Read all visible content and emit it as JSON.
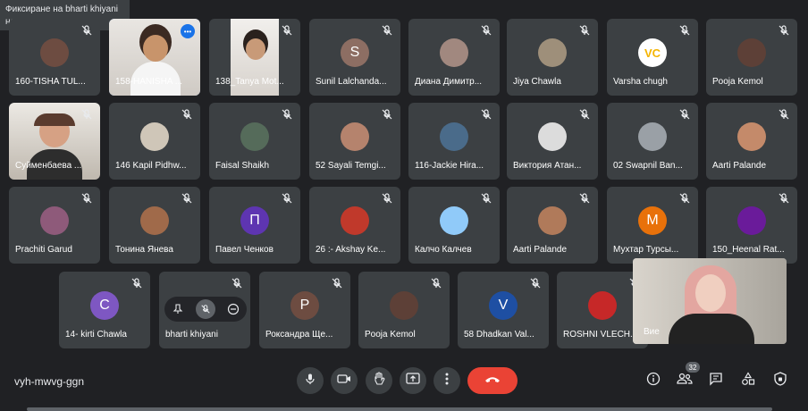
{
  "tooltip": "Фиксиране на bharti khiyani на основния ви екран",
  "meeting_code": "vyh-mwvg-ggn",
  "participant_count": "32",
  "self_label": "Вие",
  "tiles": [
    {
      "name": "160-TISHA TUL..."
    },
    {
      "name": "158-HANISHA ..."
    },
    {
      "name": "138_Tanya Mot..."
    },
    {
      "name": "Sunil Lalchanda...",
      "initial": "S",
      "color": "#8d6e63"
    },
    {
      "name": "Диана Димитр..."
    },
    {
      "name": "Jiya Chawla"
    },
    {
      "name": "Varsha chugh",
      "initial": "VC",
      "color": "#ffffff"
    },
    {
      "name": "Pooja Kemol"
    },
    {
      "name": "Суйменбаева ..."
    },
    {
      "name": "146 Kapil Pidhw..."
    },
    {
      "name": "Faisal Shaikh"
    },
    {
      "name": "52 Sayali Temgi..."
    },
    {
      "name": "116-Jackie Hira..."
    },
    {
      "name": "Виктория Атан..."
    },
    {
      "name": "02 Swapnil Ban..."
    },
    {
      "name": "Aarti Palande"
    },
    {
      "name": "Prachiti Garud"
    },
    {
      "name": "Тонина Янева"
    },
    {
      "name": "Павел Ченков",
      "initial": "П",
      "color": "#5e35b1"
    },
    {
      "name": "26 :- Akshay Ke..."
    },
    {
      "name": "Калчо Калчев"
    },
    {
      "name": "Aarti Palande"
    },
    {
      "name": "Мухтар Турсы...",
      "initial": "М",
      "color": "#e8710a"
    },
    {
      "name": "150_Heenal Rat..."
    },
    {
      "name": "14- kirti Chawla",
      "initial": "C",
      "color": "#7e57c2"
    },
    {
      "name": "bharti khiyani"
    },
    {
      "name": "Роксандра Ще...",
      "initial": "Р",
      "color": "#6d4c41"
    },
    {
      "name": "Pooja Kemol"
    },
    {
      "name": "58 Dhadkan Val...",
      "initial": "V",
      "color": "#1e4fa3"
    },
    {
      "name": "ROSHNI VLECH..."
    }
  ],
  "icons": {
    "mic": "microphone-icon",
    "camera": "camera-icon",
    "hand": "raise-hand-icon",
    "present": "present-icon",
    "more": "more-icon",
    "end": "end-call-icon",
    "info": "info-icon",
    "people": "people-icon",
    "chat": "chat-icon",
    "activities": "activities-icon",
    "security": "host-controls-icon"
  },
  "colors": {
    "end_call": "#ea4335",
    "tile_bg": "#3c4043",
    "page_bg": "#202124"
  }
}
